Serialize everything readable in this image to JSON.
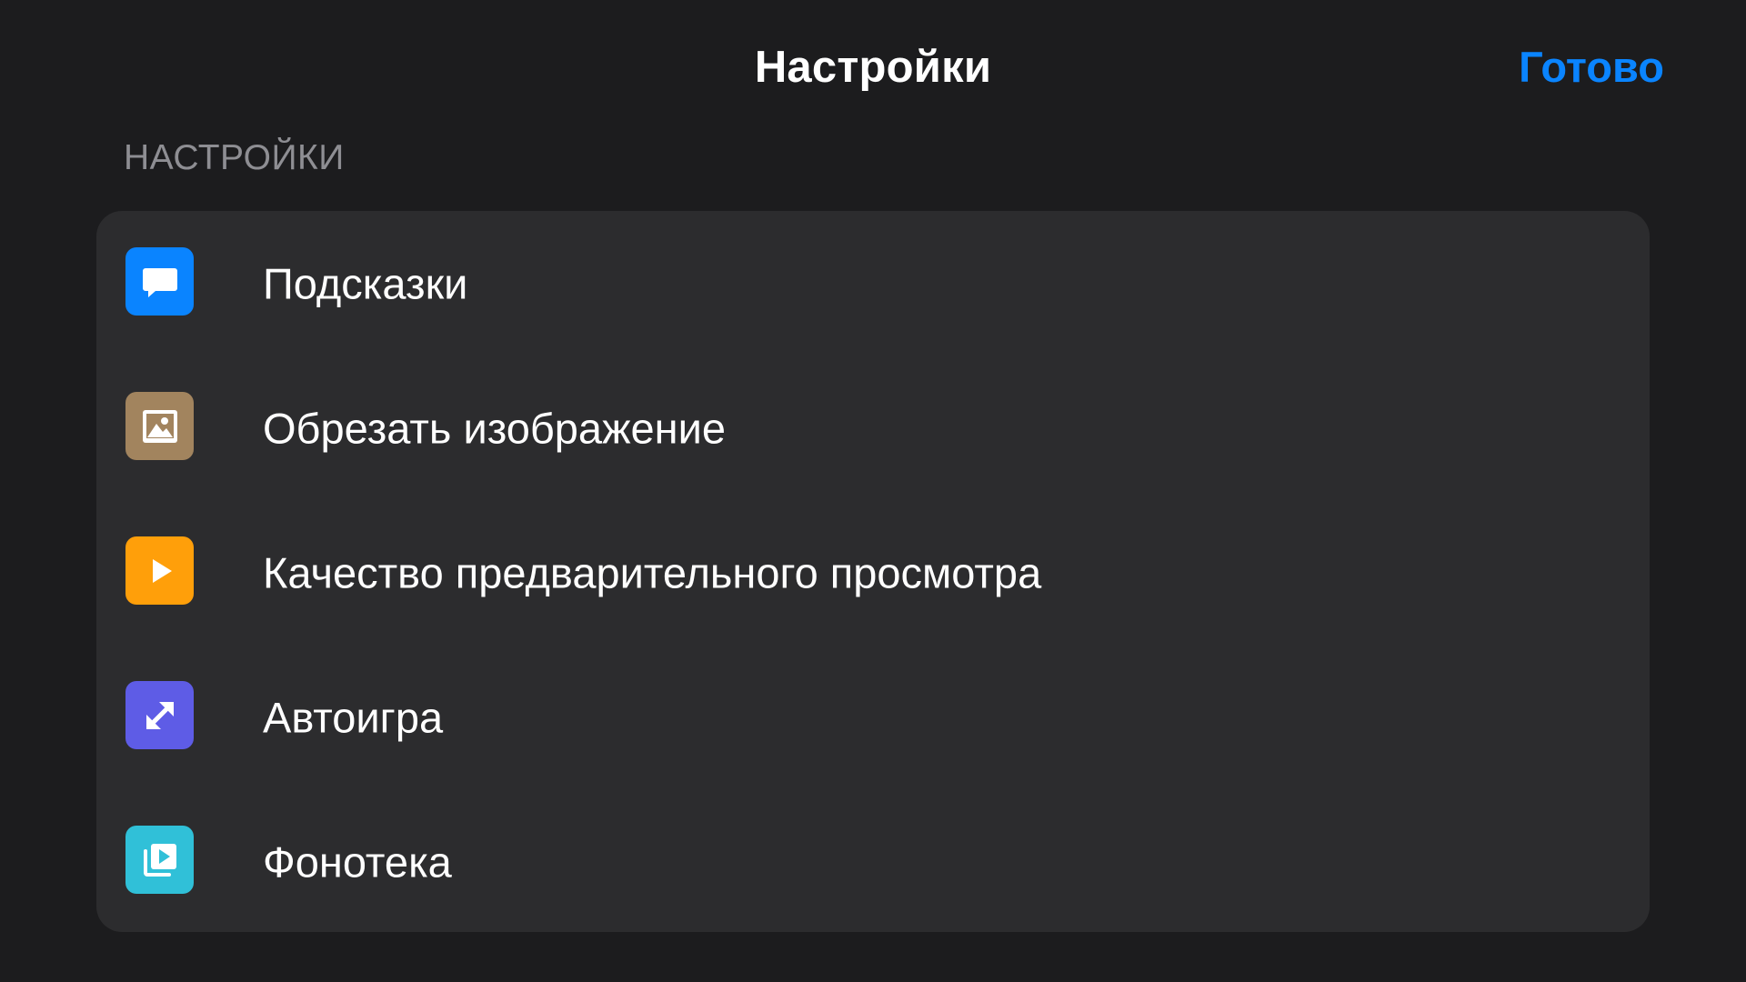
{
  "nav": {
    "title": "Настройки",
    "done_label": "Готово",
    "accent_color": "#0a84ff"
  },
  "section": {
    "header": "НАСТРОЙКИ"
  },
  "settings": {
    "items": [
      {
        "label": "Подсказки",
        "icon": "chat-bubble-icon",
        "icon_color": "#0a84ff"
      },
      {
        "label": "Обрезать изображение",
        "icon": "photo-icon",
        "icon_color": "#a2845e"
      },
      {
        "label": "Качество предварительного просмотра",
        "icon": "play-icon",
        "icon_color": "#ff9f0a"
      },
      {
        "label": "Автоигра",
        "icon": "expand-arrows-icon",
        "icon_color": "#5e5ce6"
      },
      {
        "label": "Фонотека",
        "icon": "media-library-icon",
        "icon_color": "#30c0d8"
      }
    ]
  }
}
